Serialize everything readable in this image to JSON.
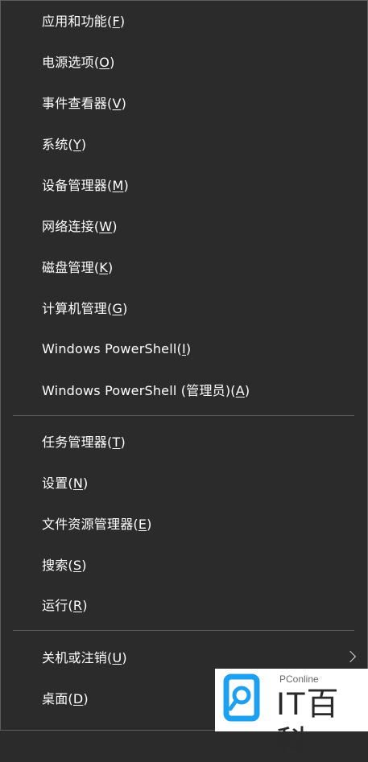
{
  "menu": {
    "group1": [
      {
        "text": "应用和功能",
        "key": "F"
      },
      {
        "text": "电源选项",
        "key": "O"
      },
      {
        "text": "事件查看器",
        "key": "V"
      },
      {
        "text": "系统",
        "key": "Y"
      },
      {
        "text": "设备管理器",
        "key": "M"
      },
      {
        "text": "网络连接",
        "key": "W"
      },
      {
        "text": "磁盘管理",
        "key": "K"
      },
      {
        "text": "计算机管理",
        "key": "G"
      },
      {
        "text": "Windows PowerShell",
        "key": "I"
      },
      {
        "text": "Windows PowerShell (管理员)",
        "key": "A"
      }
    ],
    "group2": [
      {
        "text": "任务管理器",
        "key": "T"
      },
      {
        "text": "设置",
        "key": "N"
      },
      {
        "text": "文件资源管理器",
        "key": "E"
      },
      {
        "text": "搜索",
        "key": "S"
      },
      {
        "text": "运行",
        "key": "R"
      }
    ],
    "group3": [
      {
        "text": "关机或注销",
        "key": "U",
        "has_submenu": true
      },
      {
        "text": "桌面",
        "key": "D"
      }
    ]
  },
  "watermark": {
    "small": "PConline",
    "big": "IT百科",
    "logo_icon": "magnifier-logo-icon",
    "accent": "#1ea0f0"
  },
  "colors": {
    "background": "#2b2b2b",
    "text": "#ffffff",
    "separator": "#5a5a5a"
  }
}
